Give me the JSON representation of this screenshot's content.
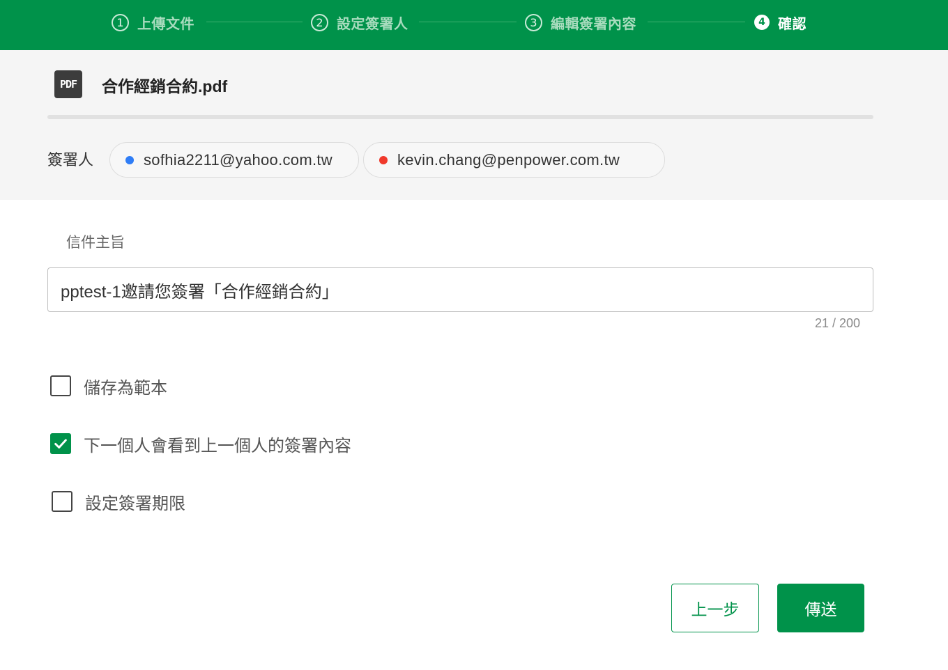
{
  "stepper": {
    "steps": [
      {
        "num": "1",
        "label": "上傳文件"
      },
      {
        "num": "2",
        "label": "設定簽署人"
      },
      {
        "num": "3",
        "label": "編輯簽署內容"
      },
      {
        "num": "4",
        "label": "確認"
      }
    ],
    "active_index": 3
  },
  "file": {
    "icon_text": "PDF",
    "name": "合作經銷合約.pdf"
  },
  "signers": {
    "label": "簽署人",
    "items": [
      {
        "email": "sofhia2211@yahoo.com.tw",
        "color": "#2f7df6"
      },
      {
        "email": "kevin.chang@penpower.com.tw",
        "color": "#f0392b"
      }
    ]
  },
  "subject": {
    "label": "信件主旨",
    "value": "pptest-1邀請您簽署「合作經銷合約」",
    "counter": "21 / 200"
  },
  "options": [
    {
      "label": "儲存為範本",
      "checked": false
    },
    {
      "label": "下一個人會看到上一個人的簽署內容",
      "checked": true
    },
    {
      "label": "設定簽署期限",
      "checked": false
    }
  ],
  "buttons": {
    "prev_label": "上一步",
    "send_label": "傳送"
  },
  "colors": {
    "brand_green": "#00924a"
  }
}
